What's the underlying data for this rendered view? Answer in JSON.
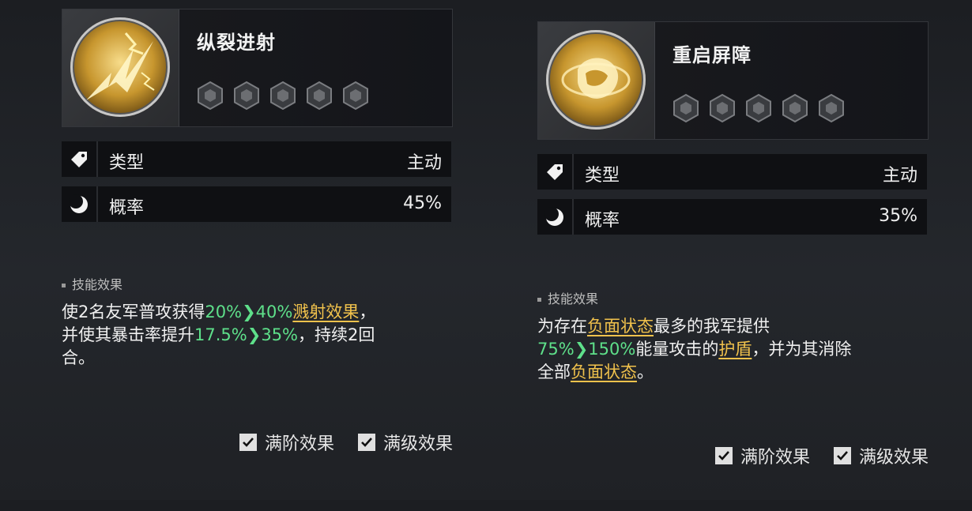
{
  "left": {
    "name": "纵裂进射",
    "type_label": "类型",
    "type_value": "主动",
    "rate_label": "概率",
    "rate_value": "45%",
    "section_title": "技能效果",
    "desc": {
      "t1": "使2名友军普攻获得",
      "v1a": "20%",
      "v1b": "40%",
      "k1": "溅射效果",
      "t2": "，",
      "t3": "并使其暴击率提升",
      "v2a": "17.5%",
      "v2b": "35%",
      "t4": "，持续2回",
      "t5": "合。"
    },
    "check1": "满阶效果",
    "check2": "满级效果"
  },
  "right": {
    "name": "重启屏障",
    "type_label": "类型",
    "type_value": "主动",
    "rate_label": "概率",
    "rate_value": "35%",
    "section_title": "技能效果",
    "desc": {
      "t1": "为存在",
      "k1": "负面状态",
      "t2": "最多的我军提供",
      "v1a": "75%",
      "v1b": "150%",
      "t3": "能量攻击的",
      "k2": "护盾",
      "t4": "，并为其消除",
      "t5": "全部",
      "k3": "负面状态",
      "t6": "。"
    },
    "check1": "满阶效果",
    "check2": "满级效果"
  },
  "arrow_glyph": "❯",
  "colors": {
    "green": "#5ee08a",
    "gold": "#f1c24c",
    "bg": "#1f2125"
  }
}
